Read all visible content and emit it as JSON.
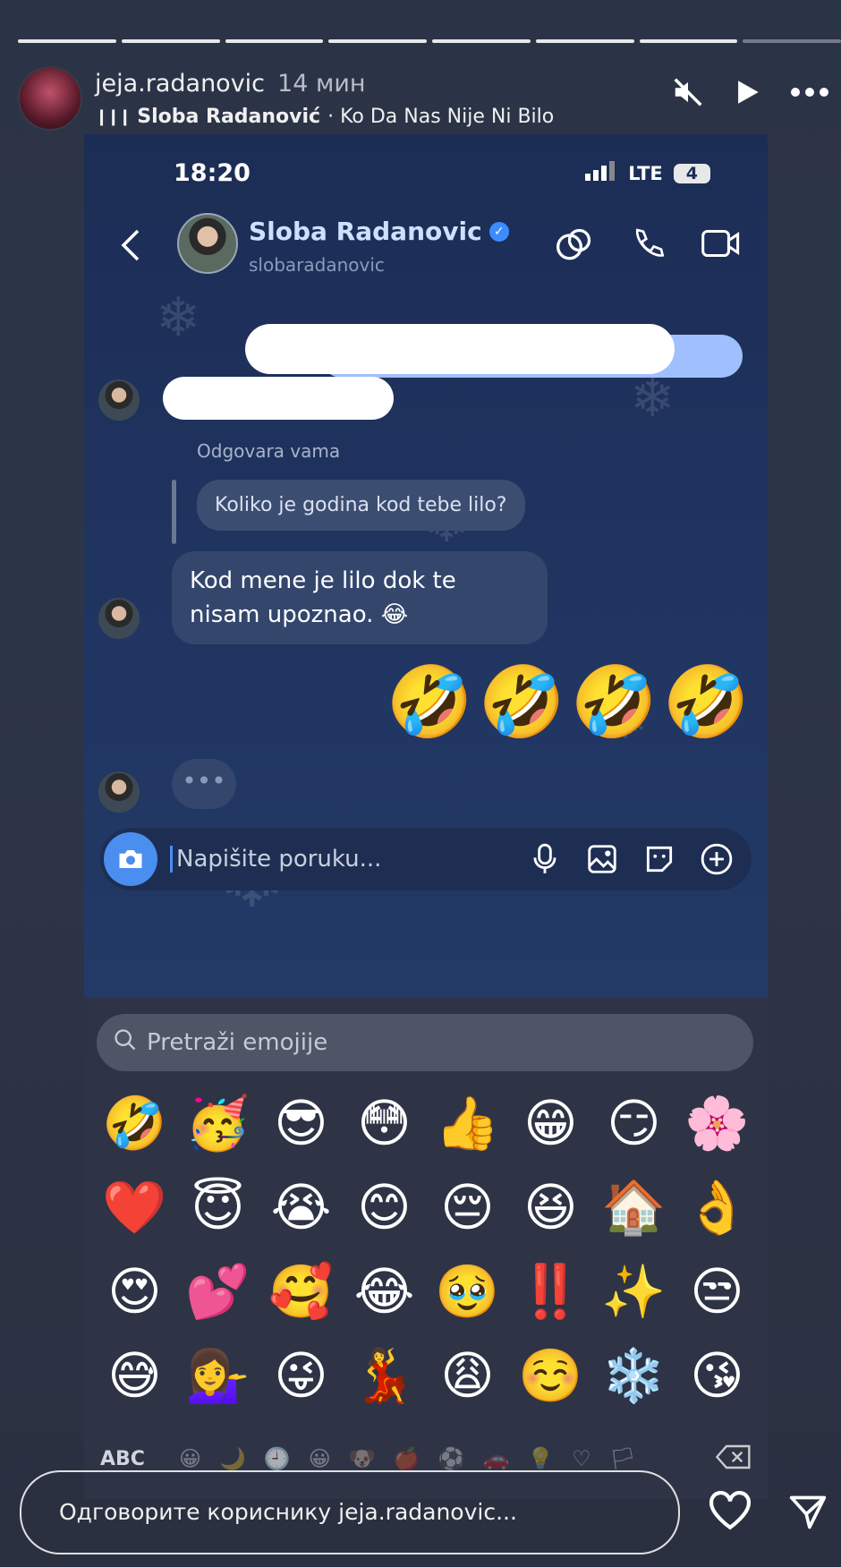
{
  "story": {
    "username": "jeja.radanovic",
    "time_ago": "14 мин",
    "music_artist": "Sloba Radanović",
    "music_song": "· Ko Da Nas Nije Ni Bilo",
    "reply_placeholder": "Одговорите кориснику jeja.radanovic..."
  },
  "phone": {
    "time": "18:20",
    "network": "LTE",
    "battery": "4"
  },
  "chat": {
    "contact_name": "Sloba Radanovic",
    "contact_handle": "slobaradanovic",
    "reply_label": "Odgovara vama",
    "replied_message": "Koliko je godina kod tebe lilo?",
    "message": "Kod mene je lilo dok te nisam upoznao. 😂",
    "sent_emojis": "🤣🤣🤣🤣",
    "typing": "•••",
    "input_placeholder": "Napišite poruku..."
  },
  "keyboard": {
    "search_placeholder": "Pretraži emojije",
    "emojis": [
      "🤣",
      "🥳",
      "😎",
      "😳",
      "👍",
      "😁",
      "😏",
      "🌸",
      "❤️",
      "😇",
      "😭",
      "😊",
      "😔",
      "😆",
      "🏠",
      "👌",
      "😍",
      "💕",
      "🥰",
      "😂",
      "🥹",
      "‼️",
      "✨",
      "😒",
      "😅",
      "💁‍♀️",
      "😜",
      "💃",
      "😩",
      "☺️",
      "❄️",
      "😘"
    ],
    "abc_label": "ABC",
    "categories": [
      "😀",
      "🌙",
      "🕘",
      "😀",
      "🐶",
      "🍎",
      "⚽",
      "🚗",
      "💡",
      "♡",
      "🏳"
    ]
  }
}
